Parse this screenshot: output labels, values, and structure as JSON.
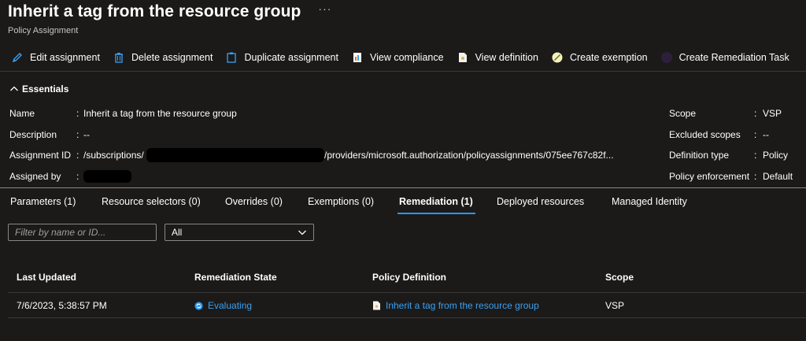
{
  "header": {
    "title": "Inherit a tag from the resource group",
    "more": "···",
    "subtitle": "Policy Assignment"
  },
  "toolbar": {
    "edit": "Edit assignment",
    "delete": "Delete assignment",
    "duplicate": "Duplicate assignment",
    "view_compliance": "View compliance",
    "view_definition": "View definition",
    "create_exemption": "Create exemption",
    "create_remediation": "Create Remediation Task"
  },
  "essentials": {
    "header": "Essentials",
    "left": [
      {
        "label": "Name",
        "colon": ":",
        "value": "Inherit a tag from the resource group"
      },
      {
        "label": "Description",
        "colon": ":",
        "value": "--"
      },
      {
        "label": "Assignment ID",
        "colon": ":",
        "value_prefix": "/subscriptions/",
        "value_suffix": "/providers/microsoft.authorization/policyassignments/075ee767c82f..."
      },
      {
        "label": "Assigned by",
        "colon": ":",
        "value": ""
      }
    ],
    "right": [
      {
        "label": "Scope",
        "colon": ":",
        "value": "VSP"
      },
      {
        "label": "Excluded scopes",
        "colon": ":",
        "value": "--"
      },
      {
        "label": "Definition type",
        "colon": ":",
        "value": "Policy"
      },
      {
        "label": "Policy enforcement",
        "colon": ":",
        "value": "Default"
      }
    ]
  },
  "tabs": [
    {
      "label": "Parameters (1)"
    },
    {
      "label": "Resource selectors (0)"
    },
    {
      "label": "Overrides (0)"
    },
    {
      "label": "Exemptions (0)"
    },
    {
      "label": "Remediation (1)"
    },
    {
      "label": "Deployed resources"
    },
    {
      "label": "Managed Identity"
    }
  ],
  "active_tab": "Remediation (1)",
  "filter": {
    "placeholder": "Filter by name or ID...",
    "select_value": "All"
  },
  "table": {
    "columns": [
      "Last Updated",
      "Remediation State",
      "Policy Definition",
      "Scope"
    ],
    "rows": [
      {
        "last_updated": "7/6/2023, 5:38:57 PM",
        "state": "Evaluating",
        "definition": "Inherit a tag from the resource group",
        "scope": "VSP"
      }
    ]
  },
  "colors": {
    "background": "#1b1a19",
    "accent": "#2899f5",
    "link": "#3aa0f3",
    "divider": "#3b3a39"
  }
}
